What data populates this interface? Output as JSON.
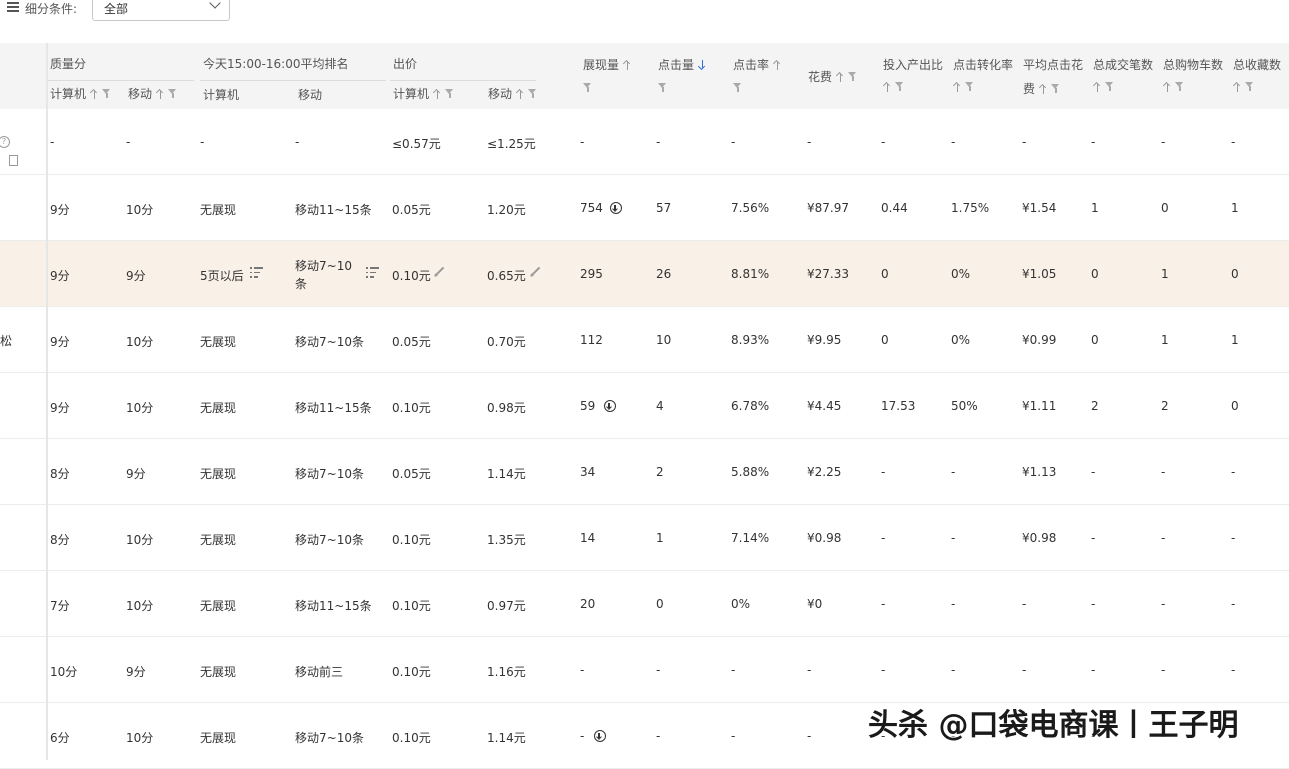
{
  "filter": {
    "label": "细分条件:",
    "selected": "全部"
  },
  "header": {
    "quality": "质量分",
    "rank_group": "今天15:00-16:00平均排名",
    "bid": "出价",
    "pc": "计算机",
    "mobile": "移动",
    "impressions": "展现量",
    "clicks": "点击量",
    "ctr": "点击率",
    "cost": "花费",
    "roi": "投入产出比",
    "cvr": "点击转化率",
    "cpc_line1": "平均点击花",
    "cpc_line2": "费",
    "deals": "总成交笔数",
    "cart": "总购物车数",
    "fav": "总收藏数"
  },
  "left_fragments": {
    "help": "?",
    "row3_text": "松"
  },
  "rows": [
    {
      "q_pc": "-",
      "q_m": "-",
      "r_pc": "-",
      "r_m": "-",
      "b_pc": "≤0.57元",
      "b_m": "≤1.25元",
      "imp": "-",
      "clk": "-",
      "ctr": "-",
      "cost": "-",
      "roi": "-",
      "cvr": "-",
      "cpc": "-",
      "deals": "-",
      "cart": "-",
      "fav": "-"
    },
    {
      "q_pc": "9分",
      "q_m": "10分",
      "r_pc": "无展现",
      "r_m": "移动11~15条",
      "b_pc": "0.05元",
      "b_m": "1.20元",
      "imp": "754",
      "clk": "57",
      "ctr": "7.56%",
      "cost": "¥87.97",
      "roi": "0.44",
      "cvr": "1.75%",
      "cpc": "¥1.54",
      "deals": "1",
      "cart": "0",
      "fav": "1"
    },
    {
      "q_pc": "9分",
      "q_m": "9分",
      "r_pc": "5页以后",
      "r_m1": "移动7~10",
      "r_m2": "条",
      "b_pc": "0.10元",
      "b_m": "0.65元",
      "imp": "295",
      "clk": "26",
      "ctr": "8.81%",
      "cost": "¥27.33",
      "roi": "0",
      "cvr": "0%",
      "cpc": "¥1.05",
      "deals": "0",
      "cart": "1",
      "fav": "0"
    },
    {
      "q_pc": "9分",
      "q_m": "10分",
      "r_pc": "无展现",
      "r_m": "移动7~10条",
      "b_pc": "0.05元",
      "b_m": "0.70元",
      "imp": "112",
      "clk": "10",
      "ctr": "8.93%",
      "cost": "¥9.95",
      "roi": "0",
      "cvr": "0%",
      "cpc": "¥0.99",
      "deals": "0",
      "cart": "1",
      "fav": "1"
    },
    {
      "q_pc": "9分",
      "q_m": "10分",
      "r_pc": "无展现",
      "r_m": "移动11~15条",
      "b_pc": "0.10元",
      "b_m": "0.98元",
      "imp": "59",
      "clk": "4",
      "ctr": "6.78%",
      "cost": "¥4.45",
      "roi": "17.53",
      "cvr": "50%",
      "cpc": "¥1.11",
      "deals": "2",
      "cart": "2",
      "fav": "0"
    },
    {
      "q_pc": "8分",
      "q_m": "9分",
      "r_pc": "无展现",
      "r_m": "移动7~10条",
      "b_pc": "0.05元",
      "b_m": "1.14元",
      "imp": "34",
      "clk": "2",
      "ctr": "5.88%",
      "cost": "¥2.25",
      "roi": "-",
      "cvr": "-",
      "cpc": "¥1.13",
      "deals": "-",
      "cart": "-",
      "fav": "-"
    },
    {
      "q_pc": "8分",
      "q_m": "10分",
      "r_pc": "无展现",
      "r_m": "移动7~10条",
      "b_pc": "0.10元",
      "b_m": "1.35元",
      "imp": "14",
      "clk": "1",
      "ctr": "7.14%",
      "cost": "¥0.98",
      "roi": "-",
      "cvr": "-",
      "cpc": "¥0.98",
      "deals": "-",
      "cart": "-",
      "fav": "-"
    },
    {
      "q_pc": "7分",
      "q_m": "10分",
      "r_pc": "无展现",
      "r_m": "移动11~15条",
      "b_pc": "0.10元",
      "b_m": "0.97元",
      "imp": "20",
      "clk": "0",
      "ctr": "0%",
      "cost": "¥0",
      "roi": "-",
      "cvr": "-",
      "cpc": "-",
      "deals": "-",
      "cart": "-",
      "fav": "-"
    },
    {
      "q_pc": "10分",
      "q_m": "9分",
      "r_pc": "无展现",
      "r_m": "移动前三",
      "b_pc": "0.10元",
      "b_m": "1.16元",
      "imp": "-",
      "clk": "-",
      "ctr": "-",
      "cost": "-",
      "roi": "-",
      "cvr": "-",
      "cpc": "-",
      "deals": "-",
      "cart": "-",
      "fav": "-"
    },
    {
      "q_pc": "6分",
      "q_m": "10分",
      "r_pc": "无展现",
      "r_m": "移动7~10条",
      "b_pc": "0.10元",
      "b_m": "1.14元",
      "imp": "-",
      "clk": "-",
      "ctr": "-",
      "cost": "-",
      "roi": "-",
      "cvr": "-",
      "cpc": "-",
      "deals": "-",
      "cart": "-",
      "fav": "-"
    }
  ],
  "watermark": "头杀 @口袋电商课丨王子明"
}
